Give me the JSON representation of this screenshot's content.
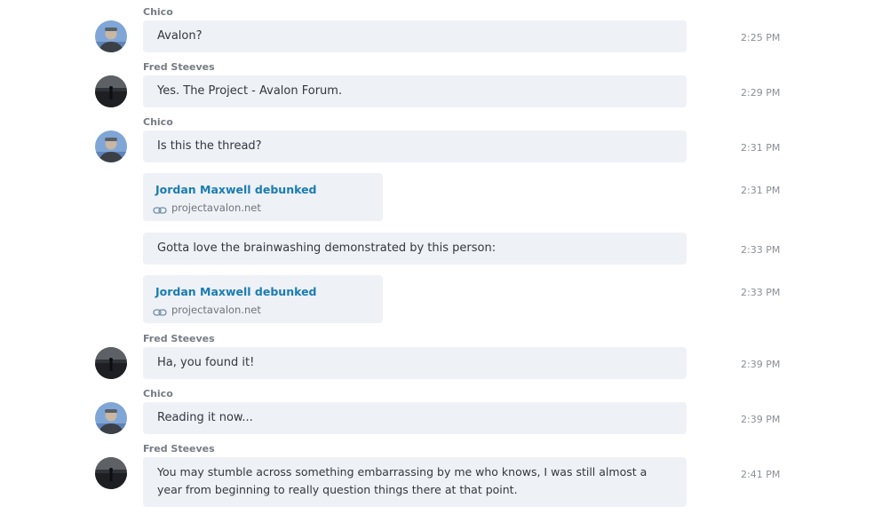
{
  "conversation": {
    "messages": [
      {
        "sender": "Chico",
        "text": "Avalon?",
        "time": "2:25 PM"
      },
      {
        "sender": "Fred Steeves",
        "text": "Yes. The Project - Avalon Forum.",
        "time": "2:29 PM"
      },
      {
        "sender": "Chico",
        "text": "Is this the thread?",
        "time": "2:31 PM"
      },
      {
        "link_title": "Jordan Maxwell debunked",
        "link_domain": "projectavalon.net",
        "time": "2:31 PM"
      },
      {
        "text": "Gotta love the brainwashing demonstrated by this person:",
        "time": "2:33 PM"
      },
      {
        "link_title": "Jordan Maxwell debunked",
        "link_domain": "projectavalon.net",
        "time": "2:33 PM"
      },
      {
        "sender": "Fred Steeves",
        "text": "Ha, you found it!",
        "time": "2:39 PM"
      },
      {
        "sender": "Chico",
        "text": "Reading it now...",
        "time": "2:39 PM"
      },
      {
        "sender": "Fred Steeves",
        "text": "You may stumble across something embarrassing by me who knows, I was still almost a year from beginning to really question things there at that point.",
        "time": "2:41 PM"
      }
    ]
  },
  "icons": {
    "chico_avatar": "avatar-chico-icon",
    "fred_avatar": "avatar-fred-steeves-icon",
    "link": "link-icon"
  },
  "colors": {
    "bubble_background": "#eef1f6",
    "link_title": "#1a7cb0",
    "sender_name": "#767c84",
    "timestamp": "#8a8f96"
  }
}
